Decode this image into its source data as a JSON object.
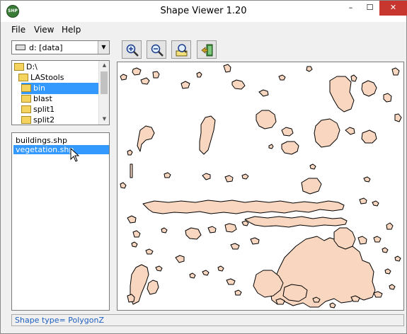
{
  "window": {
    "title": "Shape Viewer 1.20",
    "icon_text": "SHP",
    "minimize_glyph": "–",
    "maximize_glyph": "☐",
    "close_glyph": "✕"
  },
  "menu": {
    "items": [
      {
        "label": "File"
      },
      {
        "label": "View"
      },
      {
        "label": "Help"
      }
    ]
  },
  "drive": {
    "selected": "d: [data]",
    "arrow_glyph": "▼"
  },
  "toolbar": {
    "buttons": [
      {
        "name": "zoom-in",
        "icon": "magnifier-plus-icon"
      },
      {
        "name": "zoom-out",
        "icon": "magnifier-minus-icon"
      },
      {
        "name": "zoom-extent",
        "icon": "map-zoom-icon"
      },
      {
        "name": "exit",
        "icon": "exit-door-icon"
      }
    ]
  },
  "folders": {
    "items": [
      {
        "label": "D:\\",
        "selected": false
      },
      {
        "label": "LAStools",
        "selected": false
      },
      {
        "label": "bin",
        "selected": true
      },
      {
        "label": "blast",
        "selected": false
      },
      {
        "label": "split1",
        "selected": false
      },
      {
        "label": "split2",
        "selected": false
      }
    ]
  },
  "files": {
    "items": [
      {
        "label": "buildings.shp",
        "selected": false
      },
      {
        "label": "vegetation.shp",
        "selected": true
      }
    ]
  },
  "status": {
    "text": "Shape type= PolygonZ"
  },
  "colors": {
    "polygon_fill": "#f9d6bf",
    "polygon_stroke": "#000000",
    "selection": "#3399ff",
    "close_button": "#c7372f"
  }
}
